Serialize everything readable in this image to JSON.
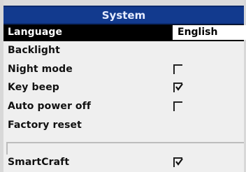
{
  "window": {
    "title": "System"
  },
  "settings": {
    "language": {
      "label": "Language",
      "value": "English"
    },
    "backlight": {
      "label": "Backlight"
    },
    "night_mode": {
      "label": "Night mode",
      "checked": false
    },
    "key_beep": {
      "label": "Key beep",
      "checked": true
    },
    "auto_power_off": {
      "label": "Auto power off",
      "checked": false
    },
    "factory_reset": {
      "label": "Factory reset"
    },
    "smartcraft": {
      "label": "SmartCraft",
      "checked": true
    }
  },
  "colors": {
    "title_bar": "#123a8e",
    "selected_row": "#000000",
    "background": "#efefef"
  }
}
